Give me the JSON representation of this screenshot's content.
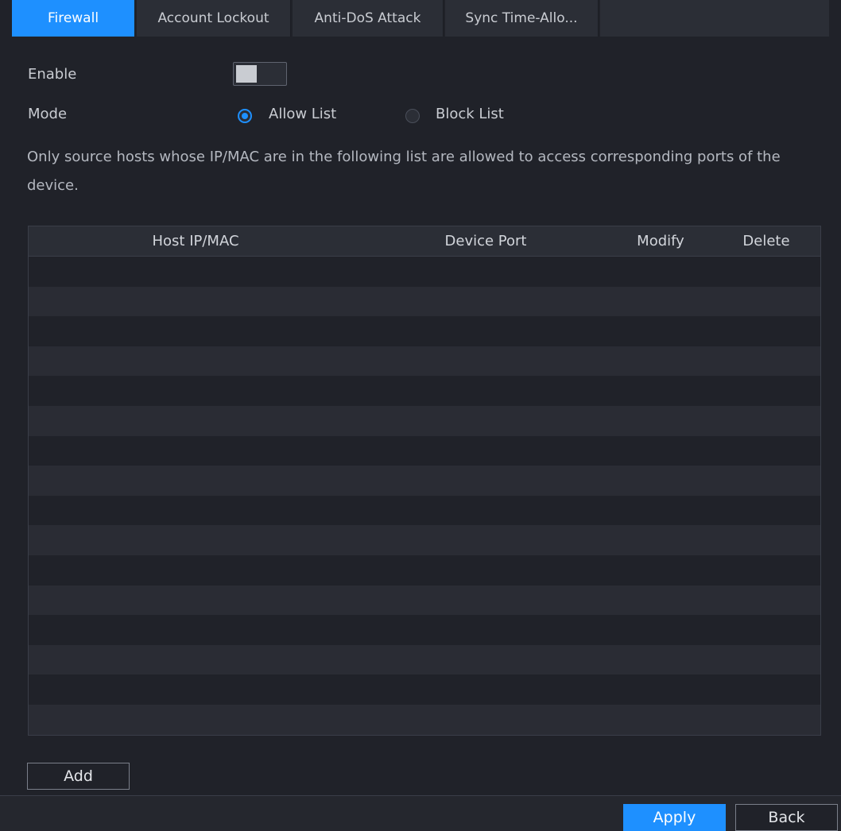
{
  "tabs": [
    {
      "label": "Firewall",
      "active": true
    },
    {
      "label": "Account Lockout",
      "active": false
    },
    {
      "label": "Anti-DoS Attack",
      "active": false
    },
    {
      "label": "Sync Time-Allo...",
      "active": false
    }
  ],
  "form": {
    "enable_label": "Enable",
    "enable_value": false,
    "mode_label": "Mode",
    "mode_options": [
      {
        "label": "Allow List",
        "selected": true
      },
      {
        "label": "Block List",
        "selected": false
      }
    ],
    "description": "Only source hosts whose IP/MAC are in the following list are allowed to access corresponding ports of the device."
  },
  "table": {
    "columns": [
      "Host IP/MAC",
      "Device Port",
      "Modify",
      "Delete"
    ],
    "rows": []
  },
  "buttons": {
    "add": "Add",
    "apply": "Apply",
    "back": "Back"
  },
  "colors": {
    "accent": "#1e90ff",
    "background": "#202229"
  }
}
